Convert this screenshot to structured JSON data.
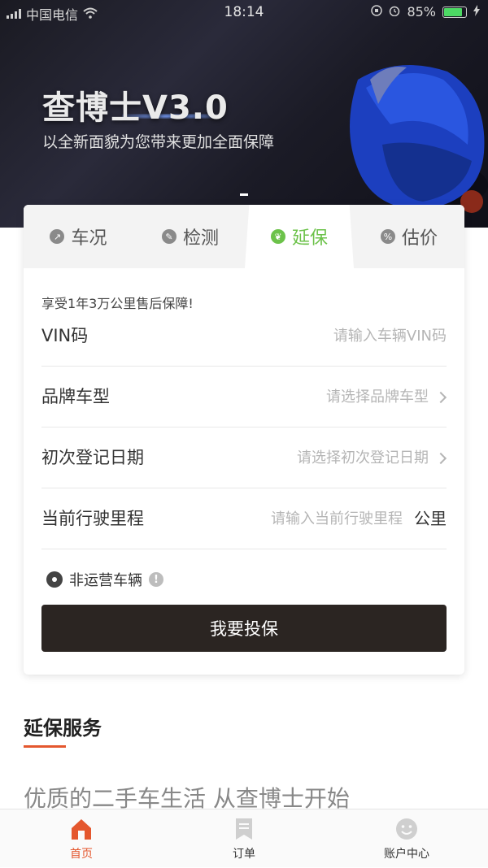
{
  "status_bar": {
    "carrier": "中国电信",
    "time": "18:14",
    "battery": "85%"
  },
  "banner": {
    "title": "查博士V3.0",
    "subtitle": "以全新面貌为您带来更加全面保障"
  },
  "tabs": [
    {
      "label": "车况",
      "icon": "chart-icon"
    },
    {
      "label": "检测",
      "icon": "wrench-icon"
    },
    {
      "label": "延保",
      "icon": "leaf-icon"
    },
    {
      "label": "估价",
      "icon": "percent-icon"
    }
  ],
  "active_tab": "延保",
  "form": {
    "promo": "享受1年3万公里售后保障!",
    "vin": {
      "label": "VIN码",
      "placeholder": "请输入车辆VIN码"
    },
    "brand": {
      "label": "品牌车型",
      "placeholder": "请选择品牌车型"
    },
    "reg_date": {
      "label": "初次登记日期",
      "placeholder": "请选择初次登记日期"
    },
    "mileage": {
      "label": "当前行驶里程",
      "placeholder": "请输入当前行驶里程",
      "unit": "公里"
    },
    "non_operating": {
      "label": "非运营车辆",
      "checked": true
    },
    "submit": "我要投保"
  },
  "section": {
    "title": "延保服务",
    "slogan": "优质的二手车生活 从查博士开始"
  },
  "tabbar": [
    {
      "label": "首页",
      "icon": "home-icon",
      "active": true
    },
    {
      "label": "订单",
      "icon": "order-icon",
      "active": false
    },
    {
      "label": "账户中心",
      "icon": "smile-icon",
      "active": false
    }
  ],
  "colors": {
    "accent_green": "#6cc24a",
    "accent_orange": "#e4572e",
    "button_dark": "#2b2522"
  }
}
